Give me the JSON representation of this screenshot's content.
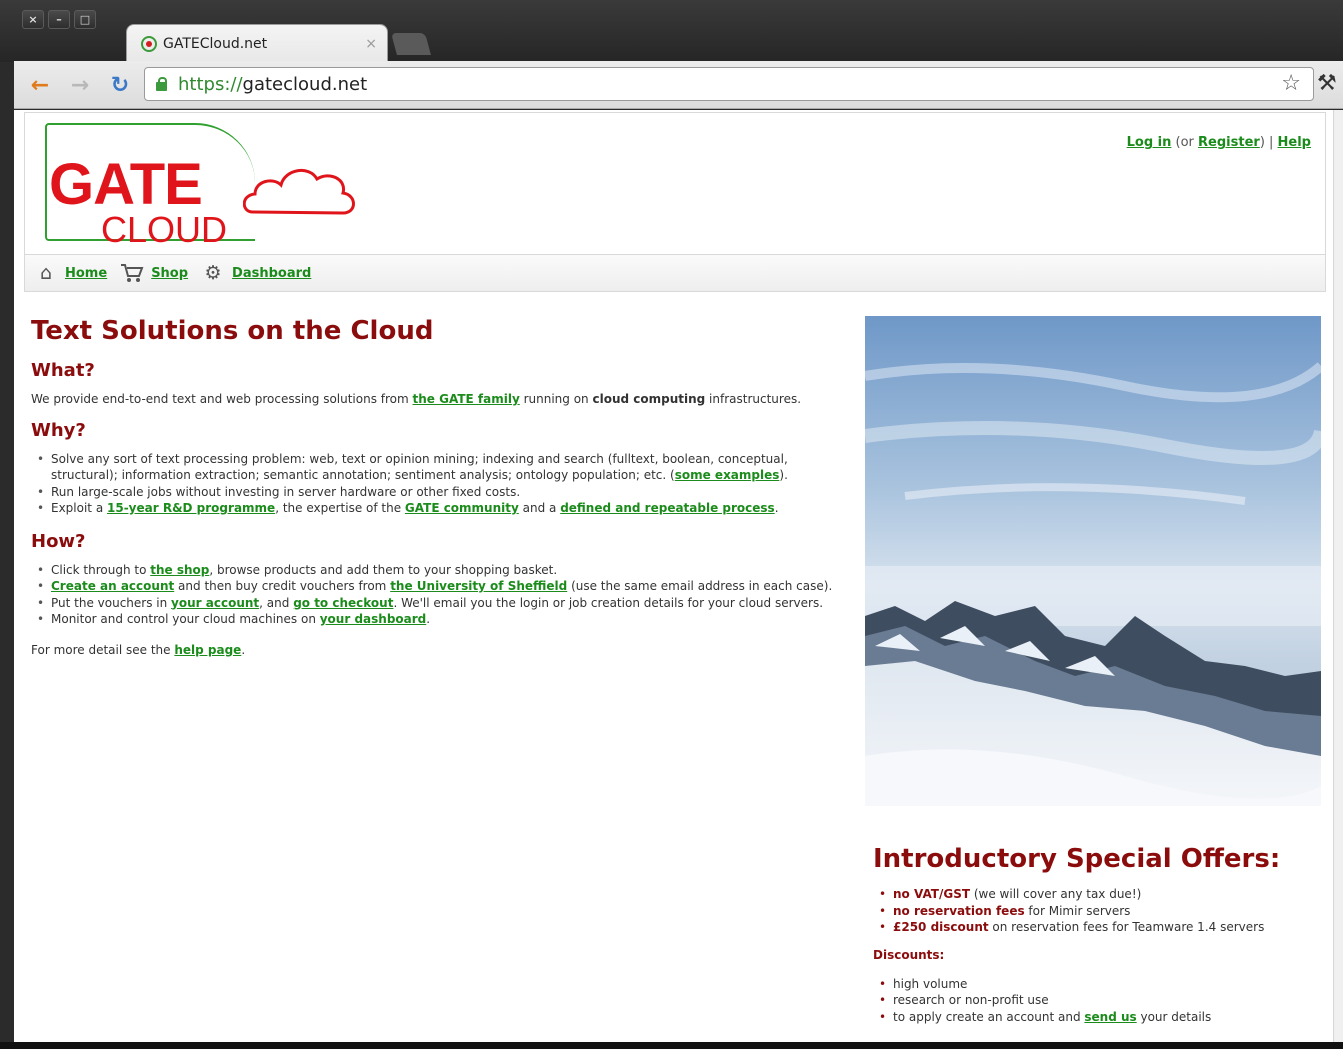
{
  "browser": {
    "tab_title": "GATECloud.net",
    "tab_close": "×",
    "url_scheme": "https://",
    "url_host": "gatecloud.net",
    "window_buttons": [
      "×",
      "–",
      "□"
    ]
  },
  "header": {
    "logo_word1": "GATE",
    "logo_word2": "CLOUD",
    "login_link": "Log in",
    "or_text": " (or ",
    "register_link": "Register",
    "close_paren_sep": ") | ",
    "help_link": "Help"
  },
  "nav": {
    "home": "Home",
    "shop": "Shop",
    "dashboard": "Dashboard"
  },
  "main": {
    "title": "Text Solutions on the Cloud",
    "what_heading": "What?",
    "what_p1": "We provide end-to-end text and web processing solutions from ",
    "what_link": "the GATE family",
    "what_p2": " running on ",
    "what_bold": "cloud computing",
    "what_p3": " infrastructures.",
    "why_heading": "Why?",
    "why_1": "Solve any sort of text processing problem: web, text or opinion mining; indexing and search (fulltext, boolean, conceptual, structural); information extraction; semantic annotation; sentiment analysis; ontology population; etc. (",
    "why_1_link": "some examples",
    "why_1_end": ").",
    "why_2": "Run large-scale jobs without investing in server hardware or other fixed costs.",
    "why_3a": "Exploit a ",
    "why_3_link1": "15-year R&D programme",
    "why_3b": ", the expertise of the ",
    "why_3_link2": "GATE community",
    "why_3c": " and a ",
    "why_3_link3": "defined and repeatable process",
    "why_3d": ".",
    "how_heading": "How?",
    "how_1a": "Click through to ",
    "how_1_link": "the shop",
    "how_1b": ", browse products and add them to your shopping basket.",
    "how_2_link1": "Create an account",
    "how_2a": " and then buy credit vouchers from ",
    "how_2_link2": "the University of Sheffield",
    "how_2b": " (use the same email address in each case).",
    "how_3a": "Put the vouchers in ",
    "how_3_link1": "your account",
    "how_3b": ", and ",
    "how_3_link2": "go to checkout",
    "how_3c": ". We'll email you the login or job creation details for your cloud servers.",
    "how_4a": "Monitor and control your cloud machines on ",
    "how_4_link": "your dashboard",
    "how_4b": ".",
    "detail_a": "For more detail see the ",
    "detail_link": "help page",
    "detail_b": "."
  },
  "offers": {
    "title": "Introductory Special Offers:",
    "o1_bold": "no VAT/GST",
    "o1_rest": " (we will cover any tax due!)",
    "o2_bold": "no reservation fees",
    "o2_rest": " for Mimir servers",
    "o3_bold": "£250 discount",
    "o3_rest": " on reservation fees for Teamware 1.4 servers",
    "discounts_heading": "Discounts:",
    "d1": "high volume",
    "d2": "research or non-profit use",
    "d3a": "to apply create an account and ",
    "d3_link": "send us",
    "d3b": " your details"
  },
  "icons": {
    "home": "home-icon",
    "shop": "cart-icon",
    "dashboard": "gear-icon",
    "star": "☆",
    "wrench": "🔧"
  },
  "colors": {
    "heading": "#8b0c0c",
    "link": "#1b8c1b",
    "logo_red": "#e0151b",
    "logo_green": "#30a030"
  }
}
